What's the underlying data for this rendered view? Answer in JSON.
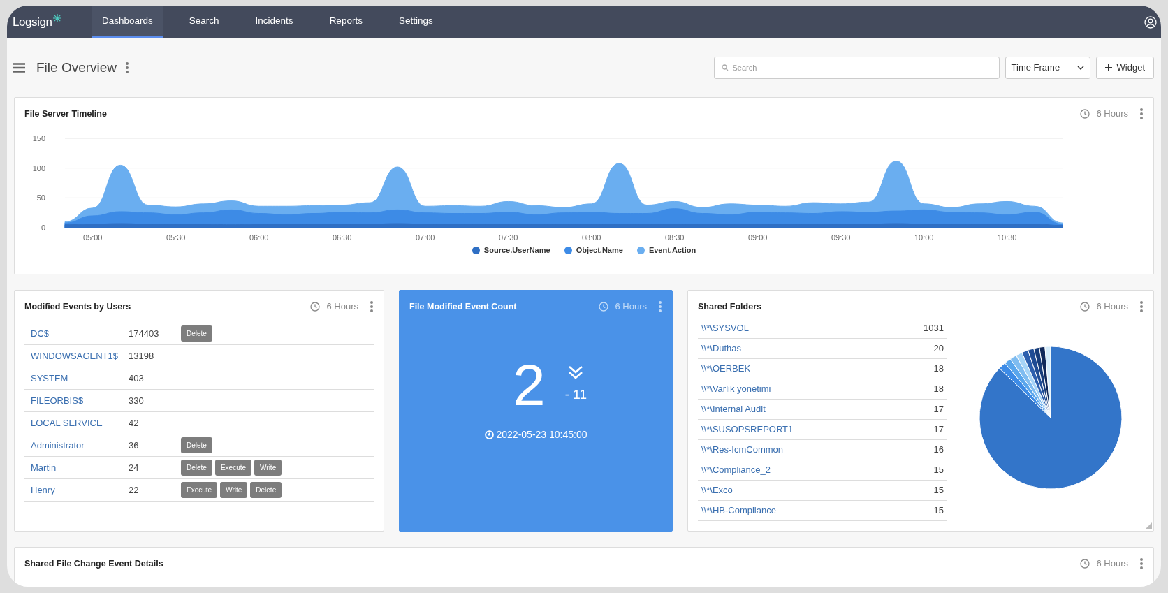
{
  "nav": {
    "logo": "Logsign",
    "tabs": [
      {
        "label": "Dashboards",
        "selected": true
      },
      {
        "label": "Search",
        "selected": false
      },
      {
        "label": "Incidents",
        "selected": false
      },
      {
        "label": "Reports",
        "selected": false
      },
      {
        "label": "Settings",
        "selected": false
      }
    ]
  },
  "page": {
    "title": "File Overview",
    "search": {
      "placeholder": "Search"
    },
    "time_frame": "Time Frame",
    "add_button": "Widget"
  },
  "timeline": {
    "title": "File Server Timeline",
    "time_range": "6 Hours",
    "chart_data": {
      "type": "area",
      "stacked": false,
      "legend": "bottom",
      "x": [
        290,
        300,
        310,
        320,
        330,
        340,
        350,
        360,
        370,
        380,
        390,
        400,
        410,
        420,
        430,
        440,
        450,
        460,
        470,
        480,
        490,
        500,
        510,
        520,
        530,
        540,
        550,
        560,
        570,
        580,
        590,
        600,
        610,
        620,
        630,
        640,
        650
      ],
      "series": [
        {
          "name": "Source.UserName",
          "color": "#2f6fc4",
          "values": [
            5,
            6,
            7,
            6,
            6,
            6,
            5,
            6,
            6,
            6,
            6,
            6,
            7,
            6,
            6,
            6,
            6,
            6,
            6,
            6,
            6,
            6,
            6,
            6,
            6,
            6,
            6,
            6,
            6,
            6,
            7,
            6,
            6,
            6,
            6,
            6,
            4
          ]
        },
        {
          "name": "Object.Name",
          "color": "#3d8be6",
          "values": [
            8,
            20,
            27,
            25,
            22,
            25,
            30,
            24,
            22,
            24,
            26,
            25,
            30,
            25,
            24,
            24,
            26,
            22,
            25,
            26,
            24,
            24,
            32,
            24,
            22,
            26,
            25,
            24,
            27,
            26,
            28,
            30,
            26,
            25,
            22,
            26,
            6
          ]
        },
        {
          "name": "Event.Action",
          "color": "#6aaef0",
          "values": [
            10,
            33,
            105,
            38,
            35,
            40,
            45,
            36,
            36,
            37,
            38,
            42,
            102,
            36,
            37,
            36,
            44,
            37,
            34,
            40,
            108,
            38,
            44,
            34,
            40,
            38,
            36,
            42,
            40,
            43,
            112,
            40,
            34,
            40,
            44,
            36,
            8
          ]
        }
      ],
      "xlim": [
        290,
        650
      ],
      "ylim": [
        0,
        150
      ],
      "yticks": [
        0,
        50,
        100,
        150
      ],
      "xticks": [
        {
          "value": 300,
          "label": "05:00"
        },
        {
          "value": 330,
          "label": "05:30"
        },
        {
          "value": 360,
          "label": "06:00"
        },
        {
          "value": 390,
          "label": "06:30"
        },
        {
          "value": 420,
          "label": "07:00"
        },
        {
          "value": 450,
          "label": "07:30"
        },
        {
          "value": 480,
          "label": "08:00"
        },
        {
          "value": 510,
          "label": "08:30"
        },
        {
          "value": 540,
          "label": "09:00"
        },
        {
          "value": 570,
          "label": "09:30"
        },
        {
          "value": 600,
          "label": "10:00"
        },
        {
          "value": 630,
          "label": "10:30"
        }
      ]
    }
  },
  "user_events": {
    "title": "Modified Events by Users",
    "time_range": "6 Hours",
    "rows": [
      {
        "user": "DC$",
        "count": "174403",
        "actions": [
          "Delete"
        ]
      },
      {
        "user": "WINDOWSAGENT1$",
        "count": "13198"
      },
      {
        "user": "SYSTEM",
        "count": "403"
      },
      {
        "user": "FILEORBIS$",
        "count": "330"
      },
      {
        "user": "LOCAL SERVICE",
        "count": "42"
      },
      {
        "user": "Administrator",
        "count": "36",
        "actions": [
          "Delete"
        ]
      },
      {
        "user": "Martin",
        "count": "24",
        "actions": [
          "Delete",
          "Execute",
          "Write"
        ]
      },
      {
        "user": "Henry",
        "count": "22",
        "actions": [
          "Execute",
          "Write",
          "Delete"
        ]
      }
    ]
  },
  "event_count": {
    "title": "File Modified Event Count",
    "time_range": "6 Hours",
    "value": "2",
    "change": "- 11",
    "timestamp": "2022-05-23 10:45:00"
  },
  "shared_folders": {
    "title": "Shared Folders",
    "time_range": "6 Hours",
    "rows": [
      {
        "path": "\\\\*\\SYSVOL",
        "count": "1031"
      },
      {
        "path": "\\\\*\\Duthas",
        "count": "20"
      },
      {
        "path": "\\\\*\\OERBEK",
        "count": "18"
      },
      {
        "path": "\\\\*\\Varlik yonetimi",
        "count": "18"
      },
      {
        "path": "\\\\*\\Internal Audit",
        "count": "17"
      },
      {
        "path": "\\\\*\\SUSOPSREPORT1",
        "count": "17"
      },
      {
        "path": "\\\\*\\Res-IcmCommon",
        "count": "16"
      },
      {
        "path": "\\\\*\\Compliance_2",
        "count": "15"
      },
      {
        "path": "\\\\*\\Exco",
        "count": "15"
      },
      {
        "path": "\\\\*\\HB-Compliance",
        "count": "15"
      }
    ]
  },
  "details": {
    "title": "Shared File Change Event Details",
    "time_range": "6 Hours"
  }
}
